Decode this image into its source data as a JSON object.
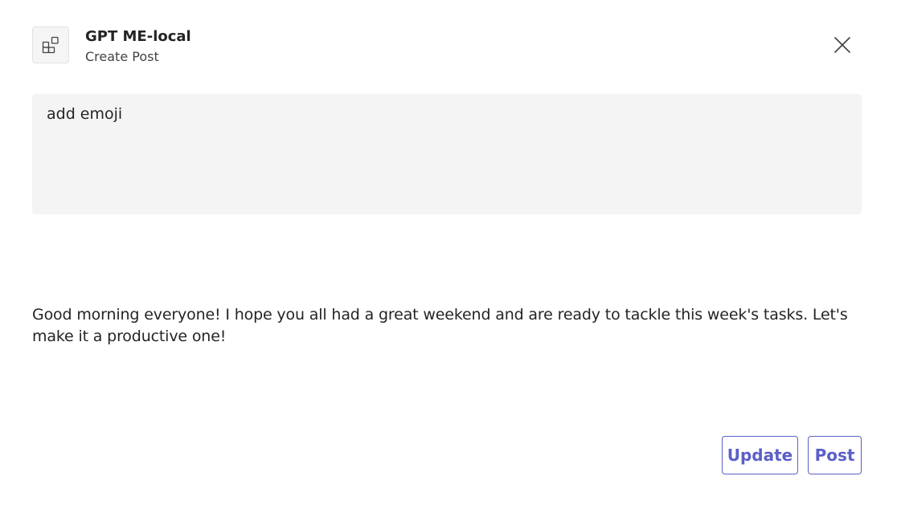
{
  "header": {
    "app_icon": "apps-grid-icon",
    "title": "GPT ME-local",
    "subtitle": "Create Post",
    "close_icon": "close-icon"
  },
  "prompt": {
    "value": "add emoji"
  },
  "result": {
    "text": "Good morning everyone! I hope you all had a great weekend and are ready to tackle this week's tasks. Let's make it a productive one!"
  },
  "actions": {
    "update_label": "Update",
    "post_label": "Post"
  },
  "colors": {
    "accent": "#5b5fc7",
    "input_background": "#f4f4f4"
  }
}
